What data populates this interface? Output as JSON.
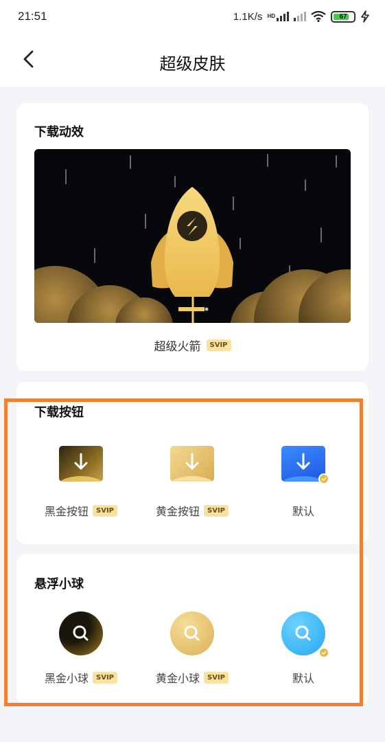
{
  "status_bar": {
    "time": "21:51",
    "speed": "1.1K/s",
    "network_tag": "HD",
    "battery_level": "67",
    "icons": [
      "signal-icon",
      "wifi-icon",
      "battery-icon",
      "charging-icon"
    ]
  },
  "header": {
    "title": "超级皮肤",
    "back_icon": "chevron-left-icon"
  },
  "download_animation": {
    "title": "下载动效",
    "item": {
      "name": "超级火箭",
      "badge": "SVIP"
    }
  },
  "download_button": {
    "title": "下载按钮",
    "options": [
      {
        "label": "黑金按钮",
        "badge": "SVIP",
        "style": "black-gold"
      },
      {
        "label": "黄金按钮",
        "badge": "SVIP",
        "style": "gold"
      },
      {
        "label": "默认",
        "badge": "",
        "style": "default",
        "selected": true
      }
    ]
  },
  "floating_ball": {
    "title": "悬浮小球",
    "options": [
      {
        "label": "黑金小球",
        "badge": "SVIP",
        "style": "black-gold"
      },
      {
        "label": "黄金小球",
        "badge": "SVIP",
        "style": "gold"
      },
      {
        "label": "默认",
        "badge": "",
        "style": "default",
        "selected": true
      }
    ]
  },
  "colors": {
    "highlight_border": "#f07f31",
    "svip_badge": "#f7e2a2",
    "default_blue": "#2f6cf0",
    "gold": "#e3b948"
  }
}
